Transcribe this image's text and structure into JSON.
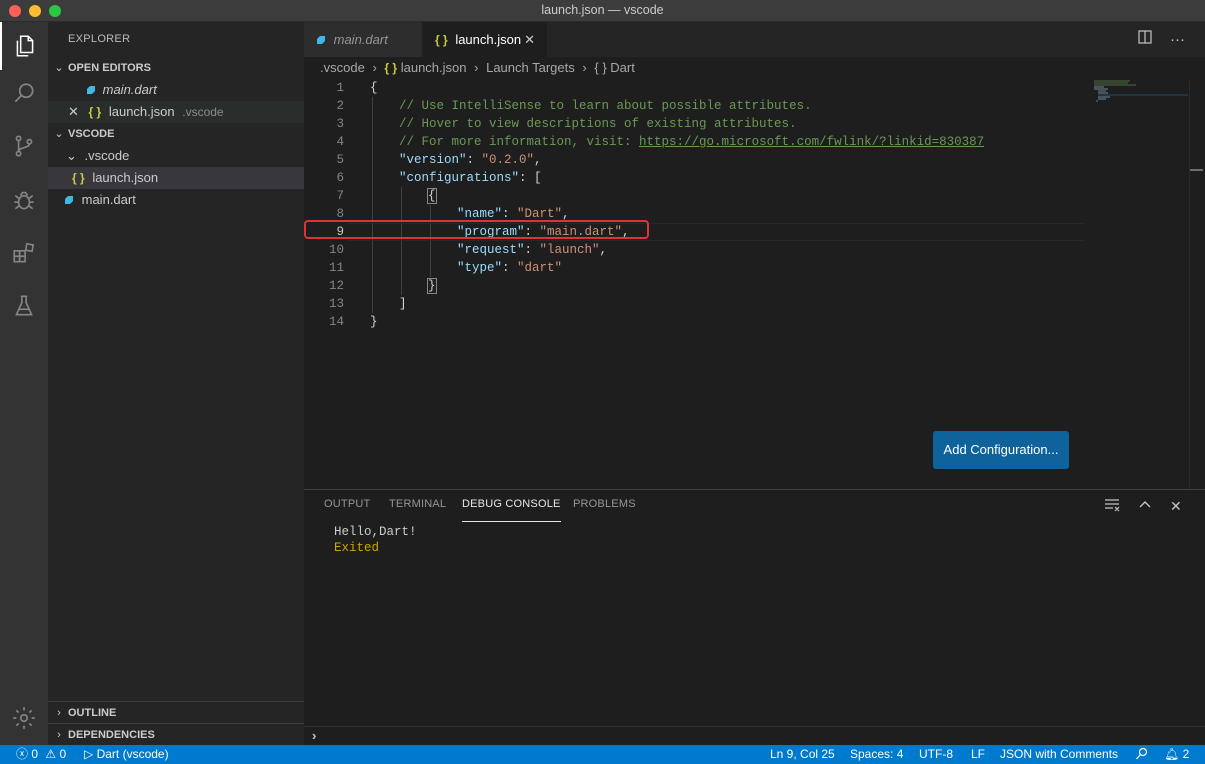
{
  "window": {
    "title": "launch.json — vscode"
  },
  "sidebar": {
    "title": "EXPLORER",
    "open_editors": {
      "header": "OPEN EDITORS",
      "items": [
        {
          "name": "main.dart",
          "desc": ""
        },
        {
          "name": "launch.json",
          "desc": ".vscode"
        }
      ]
    },
    "workspace": {
      "header": "VSCODE",
      "folder": ".vscode",
      "folder_file": "launch.json",
      "root_file": "main.dart"
    },
    "outline": "OUTLINE",
    "dependencies": "DEPENDENCIES"
  },
  "tabs": [
    {
      "label": "main.dart"
    },
    {
      "label": "launch.json"
    }
  ],
  "breadcrumb": [
    ".vscode",
    "launch.json",
    "Launch Targets",
    "Dart"
  ],
  "editor": {
    "line_numbers": [
      "1",
      "2",
      "3",
      "4",
      "5",
      "6",
      "7",
      "8",
      "9",
      "10",
      "11",
      "12",
      "13",
      "14"
    ],
    "code": {
      "l1": "{",
      "l2": "// Use IntelliSense to learn about possible attributes.",
      "l3": "// Hover to view descriptions of existing attributes.",
      "l4_pre": "// For more information, visit: ",
      "l4_link": "https://go.microsoft.com/fwlink/?linkid=830387",
      "version_key": "\"version\"",
      "version_val": "\"0.2.0\"",
      "configs_key": "\"configurations\"",
      "name_key": "\"name\"",
      "name_val": "\"Dart\"",
      "program_key": "\"program\"",
      "program_val": "\"main.dart\"",
      "request_key": "\"request\"",
      "request_val": "\"launch\"",
      "type_key": "\"type\"",
      "type_val": "\"dart\""
    },
    "add_config_label": "Add Configuration..."
  },
  "panel": {
    "tabs": [
      "OUTPUT",
      "TERMINAL",
      "DEBUG CONSOLE",
      "PROBLEMS"
    ],
    "active_tab": "DEBUG CONSOLE",
    "console": [
      {
        "text": "Hello,Dart!",
        "color": "#cccccc"
      },
      {
        "text": "Exited",
        "color": "#cca700"
      }
    ]
  },
  "statusbar": {
    "errors": "0",
    "warnings": "0",
    "debug_config": "Dart (vscode)",
    "position": "Ln 9, Col 25",
    "spaces": "Spaces: 4",
    "encoding": "UTF-8",
    "eol": "LF",
    "language": "JSON with Comments",
    "notifications": "2"
  },
  "colors": {
    "accent": "#007acc",
    "button": "#0e639c",
    "highlight_box": "#e0313a"
  }
}
